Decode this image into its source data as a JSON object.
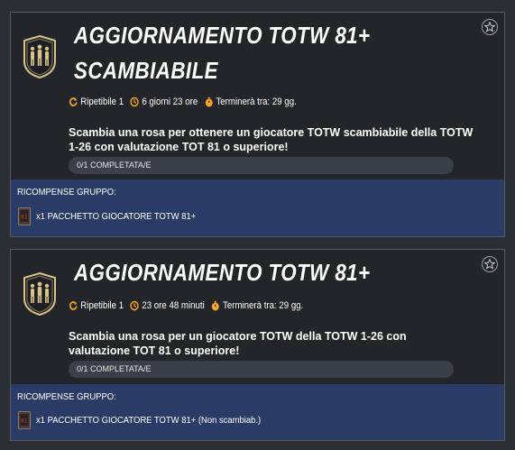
{
  "objectives": [
    {
      "title_line1": "AGGIORNAMENTO TOTW 81+",
      "title_line2": "SCAMBIABILE",
      "repeatable": "Ripetibile 1",
      "time_left": "6 giorni 23 ore",
      "ends_label": "Terminerà tra: 29 gg.",
      "description": "Scambia una rosa per ottenere un giocatore TOTW scambiabile della TOTW 1-26 con valutazione TOT 81 o superiore!",
      "progress": "0/1 COMPLETATA/E",
      "progress_fraction": 0,
      "rewards_title": "RICOMPENSE GRUPPO:",
      "reward": "x1 PACCHETTO GIOCATORE TOTW 81+"
    },
    {
      "title_line1": "AGGIORNAMENTO TOTW 81+",
      "repeatable": "Ripetibile 1",
      "time_left": "23 ore 48 minuti",
      "ends_label": "Terminerà tra: 29 gg.",
      "description": "Scambia una rosa per un giocatore TOTW della TOTW 1-26 con valutazione TOT 81 o superiore!",
      "progress": "0/1 COMPLETATA/E",
      "progress_fraction": 0,
      "rewards_title": "RICOMPENSE GRUPPO:",
      "reward": "x1 PACCHETTO GIOCATORE TOTW 81+ (Non scambiab.)"
    }
  ],
  "icons": {
    "badge": "totw-group-badge-icon",
    "favorite": "star-icon",
    "repeat": "repeat-icon",
    "timer": "clock-icon",
    "ends": "stopwatch-icon",
    "pack": "player-pack-icon"
  },
  "colors": {
    "page_bg": "#2b2e33",
    "card_bg": "#23252b",
    "rewards_bg": "#2a3b66",
    "accent": "#f5a623",
    "badge_gold": "#d8c48a"
  }
}
